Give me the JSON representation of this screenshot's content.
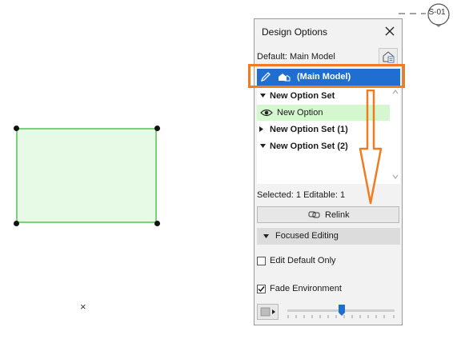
{
  "canvas": {
    "section_marker_label": "S-01",
    "x_marker": "×",
    "shape_fill": "#e6fae6",
    "shape_stroke": "#7ccf7c"
  },
  "palette": {
    "title": "Design Options",
    "default_label": "Default: Main Model",
    "main_model_label": "(Main Model)",
    "tree": [
      {
        "label": "New Option Set",
        "bold": true,
        "expanded": true
      },
      {
        "label": "New Option",
        "bold": false,
        "selected": true
      },
      {
        "label": "New Option Set (1)",
        "bold": true,
        "expanded": false
      },
      {
        "label": "New Option Set (2)",
        "bold": true,
        "expanded": true
      }
    ],
    "stats": "Selected: 1 Editable: 1",
    "relink_label": "Relink",
    "focused_editing_label": "Focused Editing",
    "edit_default_only_label": "Edit Default Only",
    "edit_default_only_checked": false,
    "fade_environment_label": "Fade Environment",
    "fade_environment_checked": true,
    "fade_level": 0.5
  },
  "colors": {
    "selection_blue": "#1f6fd0",
    "annotation_orange": "#f07c22",
    "selected_row_green": "#d4f7d0"
  }
}
